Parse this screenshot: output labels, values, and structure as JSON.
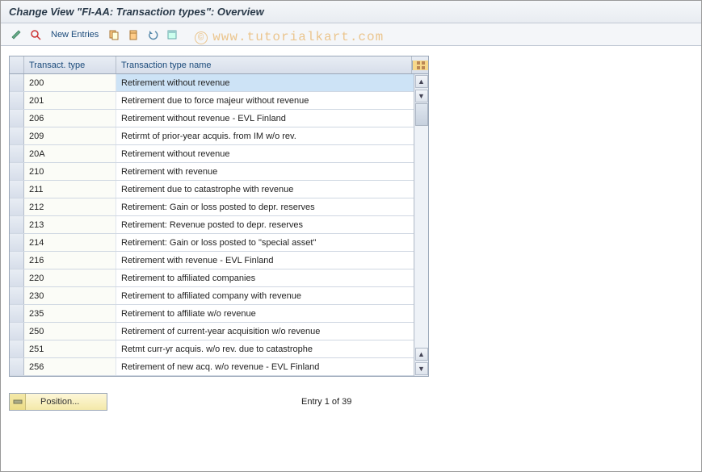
{
  "header": {
    "title": "Change View \"FI-AA: Transaction types\": Overview"
  },
  "toolbar": {
    "new_entries_label": "New Entries"
  },
  "watermark": {
    "text": "www.tutorialkart.com"
  },
  "table": {
    "headers": {
      "type": "Transact. type",
      "name": "Transaction type name"
    },
    "rows": [
      {
        "type": "200",
        "name": "Retirement without revenue",
        "selected": true
      },
      {
        "type": "201",
        "name": "Retirement due to force majeur without revenue"
      },
      {
        "type": "206",
        "name": "Retirement without revenue - EVL Finland"
      },
      {
        "type": "209",
        "name": "Retirmt of prior-year acquis. from IM w/o rev."
      },
      {
        "type": "20A",
        "name": "Retirement without revenue"
      },
      {
        "type": "210",
        "name": "Retirement with revenue"
      },
      {
        "type": "211",
        "name": "Retirement due to catastrophe with revenue"
      },
      {
        "type": "212",
        "name": "Retirement: Gain or loss posted to depr. reserves"
      },
      {
        "type": "213",
        "name": "Retirement: Revenue posted to depr. reserves"
      },
      {
        "type": "214",
        "name": "Retirement: Gain or loss posted to \"special asset\""
      },
      {
        "type": "216",
        "name": "Retirement with revenue - EVL Finland"
      },
      {
        "type": "220",
        "name": "Retirement to affiliated companies"
      },
      {
        "type": "230",
        "name": "Retirement to affiliated company with revenue"
      },
      {
        "type": "235",
        "name": "Retirement to affiliate w/o revenue"
      },
      {
        "type": "250",
        "name": "Retirement of current-year acquisition w/o revenue"
      },
      {
        "type": "251",
        "name": "Retmt curr-yr acquis. w/o rev. due to catastrophe"
      },
      {
        "type": "256",
        "name": "Retirement of new acq. w/o revenue - EVL Finland"
      }
    ]
  },
  "footer": {
    "position_label": "Position...",
    "entry_status": "Entry 1 of 39"
  }
}
